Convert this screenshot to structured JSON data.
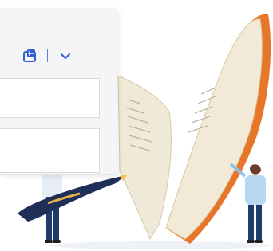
{
  "panel": {
    "toolbar": {
      "insert_icon": "table-insert-icon",
      "dropdown_icon": "chevron-down-icon",
      "accent_color": "#2f5fd6"
    },
    "fields": [
      {
        "value": "",
        "placeholder": ""
      },
      {
        "value": "",
        "placeholder": ""
      }
    ]
  },
  "illustration": {
    "subject": "open-book-with-people-and-pen"
  }
}
